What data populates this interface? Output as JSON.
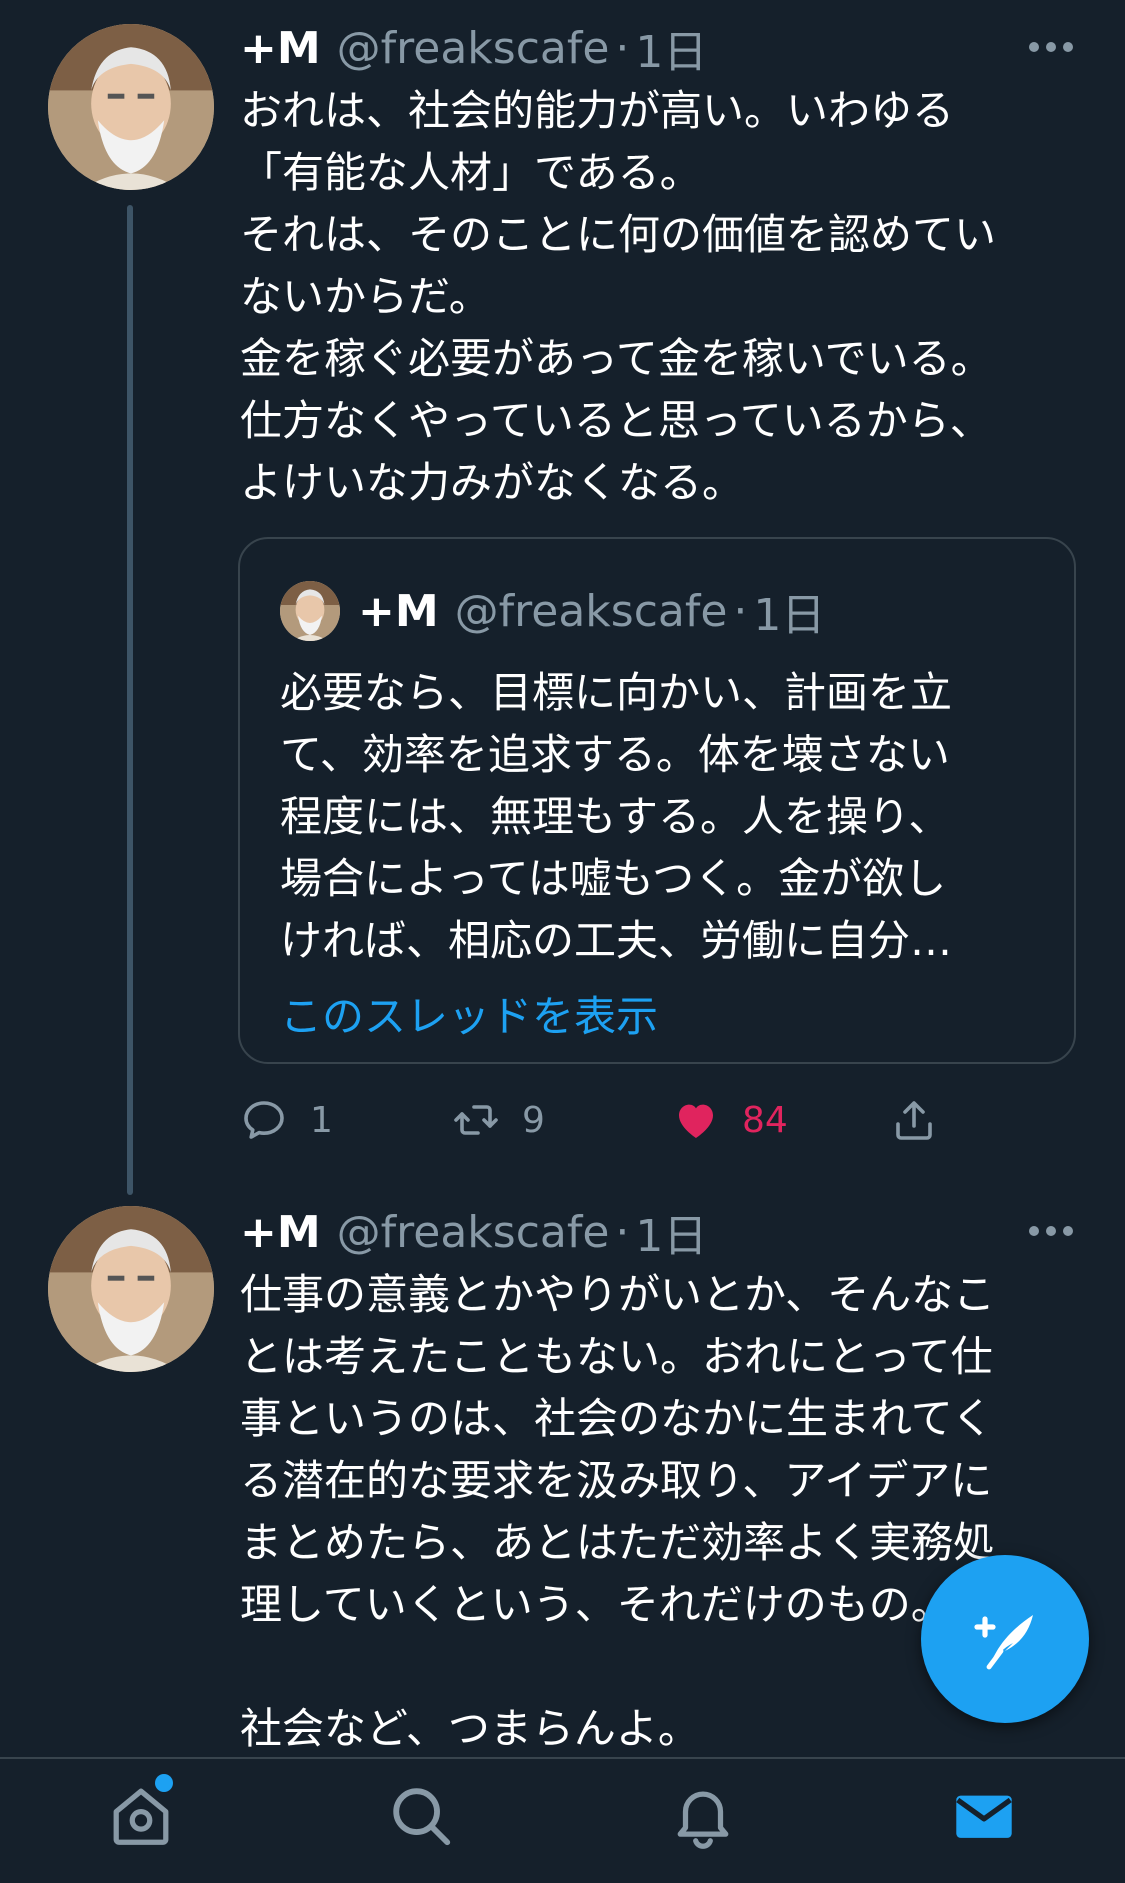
{
  "tweets": [
    {
      "name": "+M",
      "handle": "@freakscafe",
      "separator": "·",
      "time": "1日",
      "text": "おれは、社会的能力が高い。いわゆる\n「有能な人材」である。\nそれは、そのことに何の価値を認めてい\nないからだ。\n金を稼ぐ必要があって金を稼いでいる。\n仕方なくやっていると思っているから、\nよけいな力みがなくなる。",
      "quote": {
        "name": "+M",
        "handle": "@freakscafe",
        "separator": "·",
        "time": "1日",
        "text": "必要なら、目標に向かい、計画を立\nて、効率を追求する。体を壊さない\n程度には、無理もする。人を操り、\n場合によっては嘘もつく。金が欲し\nければ、相応の工夫、労働に自分…",
        "show_thread": "このスレッドを表示"
      },
      "actions": {
        "reply_count": "1",
        "retweet_count": "9",
        "like_count": "84"
      }
    },
    {
      "name": "+M",
      "handle": "@freakscafe",
      "separator": "·",
      "time": "1日",
      "text": "仕事の意義とかやりがいとか、そんなこ\nとは考えたこともない。おれにとって仕\n事というのは、社会のなかに生まれてく\nる潜在的な要求を汲み取り、アイデアに\nまとめたら、あとはただ効率よく実務処\n理していくという、それだけのもの。\n\n社会など、つまらんよ。"
    }
  ],
  "icons": {
    "reply": "reply-icon",
    "retweet": "retweet-icon",
    "like": "heart-icon",
    "share": "share-icon",
    "compose": "compose-tweet-icon",
    "home": "home-icon",
    "search": "search-icon",
    "notifications": "bell-icon",
    "messages": "mail-icon"
  },
  "colors": {
    "background": "#15202b",
    "accent": "#1da1f2",
    "like": "#e0245e",
    "secondary_text": "#8899a6",
    "border": "#38444d"
  }
}
